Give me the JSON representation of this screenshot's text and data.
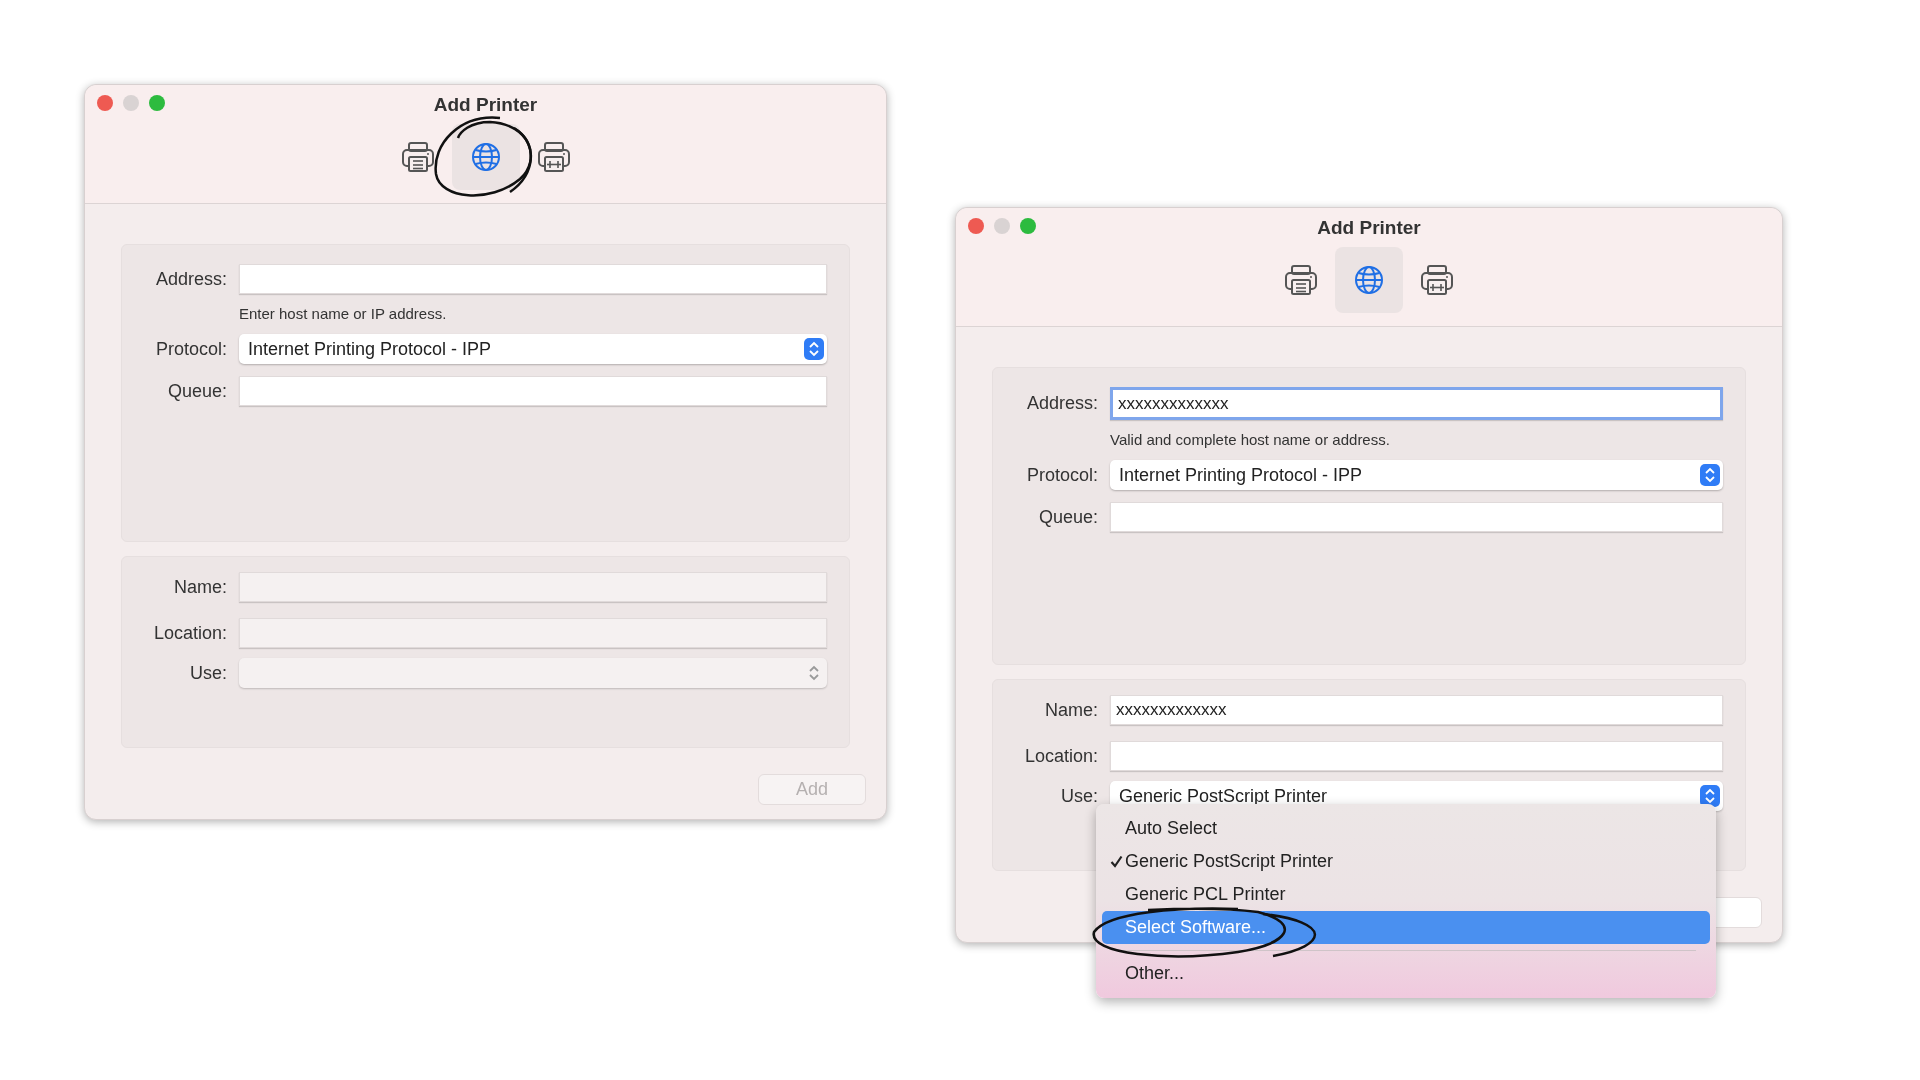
{
  "windows": [
    {
      "title": "Add Printer",
      "toolbar": [
        {
          "kind": "printer",
          "selected": false
        },
        {
          "kind": "globe",
          "selected": true
        },
        {
          "kind": "fax",
          "selected": false
        }
      ],
      "connection": {
        "address": {
          "label": "Address:",
          "focused": false
        },
        "hint": "Enter host name or IP address.",
        "protocol": {
          "label": "Protocol:",
          "value": "Internet Printing Protocol - IPP"
        },
        "queue": {
          "label": "Queue:"
        }
      },
      "details": {
        "disabled": true,
        "name": {
          "label": "Name:"
        },
        "location": {
          "label": "Location:"
        },
        "use": {
          "label": "Use:"
        }
      },
      "add_button": {
        "label": "Add",
        "disabled": true
      }
    },
    {
      "title": "Add Printer",
      "toolbar": [
        {
          "kind": "printer",
          "selected": false
        },
        {
          "kind": "globe",
          "selected": true
        },
        {
          "kind": "fax",
          "selected": false
        }
      ],
      "connection": {
        "address": {
          "label": "Address:",
          "value": "xxxxxxxxxxxxx",
          "focused": true
        },
        "hint": "Valid and complete host name or address.",
        "protocol": {
          "label": "Protocol:",
          "value": "Internet Printing Protocol - IPP"
        },
        "queue": {
          "label": "Queue:"
        }
      },
      "details": {
        "disabled": false,
        "name": {
          "label": "Name:",
          "value": "xxxxxxxxxxxxx"
        },
        "location": {
          "label": "Location:"
        },
        "use": {
          "label": "Use:",
          "value": "Generic PostScript Printer"
        }
      },
      "add_button": {
        "disabled": false
      },
      "use_menu": [
        {
          "kind": "item",
          "label": "Auto Select",
          "checked": false,
          "selected": false
        },
        {
          "kind": "item",
          "label": "Generic PostScript Printer",
          "checked": true,
          "selected": false
        },
        {
          "kind": "item",
          "label": "Generic PCL Printer",
          "checked": false,
          "selected": false
        },
        {
          "kind": "item",
          "label": "Select Software...",
          "checked": false,
          "selected": true
        },
        {
          "kind": "separator"
        },
        {
          "kind": "item",
          "label": "Other...",
          "checked": false,
          "selected": false
        }
      ]
    }
  ]
}
